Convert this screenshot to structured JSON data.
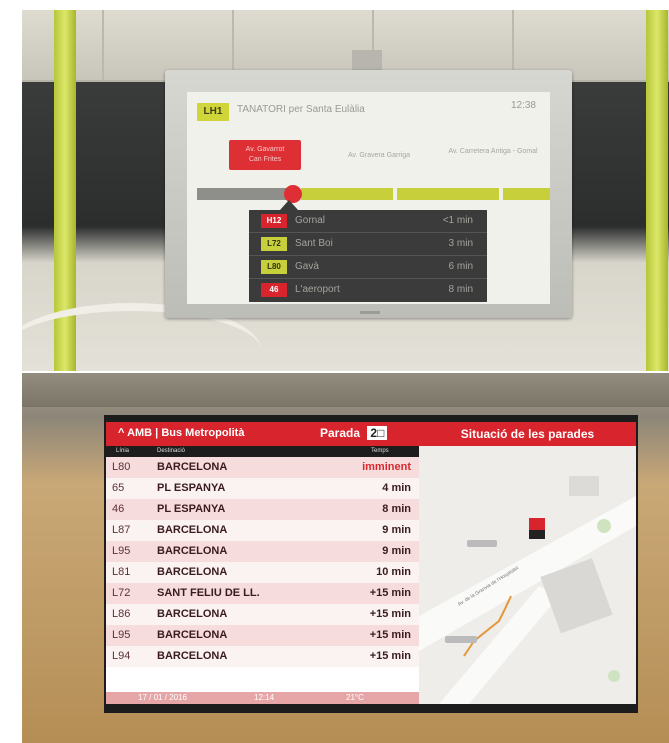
{
  "top_display": {
    "line_badge": "LH1",
    "route": "TANATORI per Santa Eulàlia",
    "clock": "12:38",
    "clock_sub": "",
    "current_stop": [
      "Av. Gavarrot",
      "Can Frites"
    ],
    "next_stops": [
      "Av. Gravera Garriga",
      "Av. Carretera Antiga - Gomal"
    ],
    "connections": [
      {
        "line": "H12",
        "dest": "Gornal",
        "time": "<1 min",
        "color": "#d8242c"
      },
      {
        "line": "L72",
        "dest": "Sant Boi",
        "time": "3 min",
        "color": "#c7d03a"
      },
      {
        "line": "L80",
        "dest": "Gavà",
        "time": "6 min",
        "color": "#c7d03a"
      },
      {
        "line": "46",
        "dest": "L'aeroport",
        "time": "8 min",
        "color": "#d8242c"
      }
    ]
  },
  "bottom_display": {
    "brand": "AMB | Bus Metropolità",
    "parada_label": "Parada",
    "parada_number": "2",
    "col_line": "Línia",
    "col_dest": "Destinació",
    "col_time": "Temps",
    "rows": [
      {
        "line": "L80",
        "dest": "BARCELONA",
        "time": "imminent"
      },
      {
        "line": "65",
        "dest": "PL ESPANYA",
        "time": "4 min"
      },
      {
        "line": "46",
        "dest": "PL ESPANYA",
        "time": "8 min"
      },
      {
        "line": "L87",
        "dest": "BARCELONA",
        "time": "9 min"
      },
      {
        "line": "L95",
        "dest": "BARCELONA",
        "time": "9 min"
      },
      {
        "line": "L81",
        "dest": "BARCELONA",
        "time": "10 min"
      },
      {
        "line": "L72",
        "dest": "SANT FELIU DE LL.",
        "time": "+15 min"
      },
      {
        "line": "L86",
        "dest": "BARCELONA",
        "time": "+15 min"
      },
      {
        "line": "L95",
        "dest": "BARCELONA",
        "time": "+15 min"
      },
      {
        "line": "L94",
        "dest": "BARCELONA",
        "time": "+15 min"
      }
    ],
    "footer_date": "17 / 01 / 2016",
    "footer_time": "12:14",
    "footer_temp": "21°C",
    "map_title": "Situació de les parades",
    "map_street": "Av. de la Granvia de l'Hospitalet"
  },
  "colors": {
    "amb_red": "#d8242c",
    "lime": "#c7d03a",
    "row_pink": "#f7dcdd"
  }
}
